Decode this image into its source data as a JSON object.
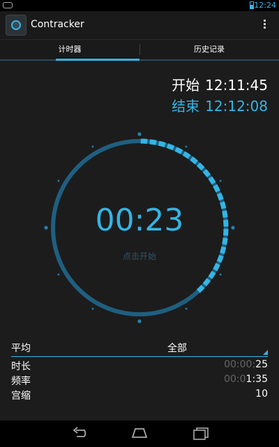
{
  "status_bar": {
    "time": "12:24"
  },
  "app": {
    "title": "Contracker"
  },
  "tabs": [
    {
      "label": "计时器",
      "active": true
    },
    {
      "label": "历史记录",
      "active": false
    }
  ],
  "session": {
    "start_label": "开始",
    "start_time": "12:11:45",
    "end_label": "结束",
    "end_time": "12:12:08"
  },
  "timer": {
    "elapsed": "00:23",
    "hint": "点击开始"
  },
  "stats": {
    "header_label": "平均",
    "filter": "全部",
    "rows": [
      {
        "label": "时长",
        "value_dim": "00:00:",
        "value": "25"
      },
      {
        "label": "频率",
        "value_dim": "00:0",
        "value": "1:35"
      },
      {
        "label": "宫缩",
        "value_dim": "",
        "value": "10"
      }
    ]
  },
  "colors": {
    "accent": "#33b5e5",
    "ring": "#1f5f80",
    "background": "#1c1c1c"
  },
  "icons": [
    "battery-icon",
    "overflow-menu-icon",
    "back-icon",
    "home-icon",
    "recent-apps-icon",
    "app-logo-icon",
    "gamepad-icon",
    "dropdown-triangle-icon"
  ]
}
